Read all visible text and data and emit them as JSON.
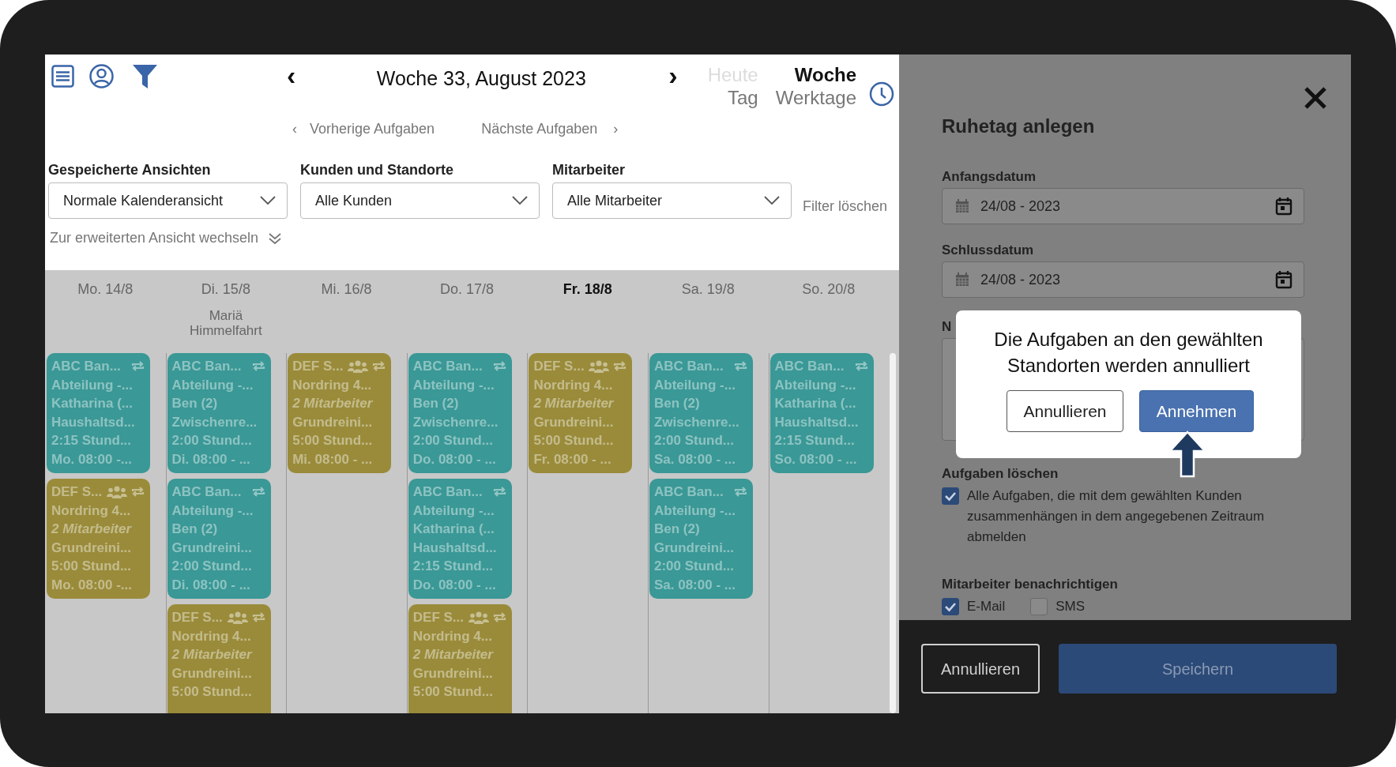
{
  "toolbar": {
    "prev": "‹",
    "title": "Woche 33, August 2023",
    "next": "›",
    "views": [
      {
        "label": "Heute",
        "selected": false,
        "disabled": true
      },
      {
        "label": "Woche",
        "selected": true,
        "disabled": false
      },
      {
        "label": "Tag",
        "selected": false,
        "disabled": false
      },
      {
        "label": "Werktage",
        "selected": false,
        "disabled": false
      }
    ]
  },
  "task_nav": {
    "prev_icon": "‹",
    "prev": "Vorherige Aufgaben",
    "next": "Nächste Aufgaben",
    "next_icon": "›"
  },
  "filters": [
    {
      "label": "Gespeicherte Ansichten",
      "value": "Normale Kalenderansicht"
    },
    {
      "label": "Kunden und Standorte",
      "value": "Alle Kunden"
    },
    {
      "label": "Mitarbeiter",
      "value": "Alle Mitarbeiter"
    }
  ],
  "clear_filters": "Filter löschen",
  "expand_view": "Zur erweiterten Ansicht wechseln",
  "days": [
    {
      "label": "Mo. 14/8",
      "selected": false,
      "tasks": [
        {
          "kind": "single",
          "color": "#3a9896",
          "lines": [
            "ABC Ban...",
            "Abteilung -...",
            "Katharina (...",
            "Haushaltsd...",
            "2:15 Stund...",
            "Mo. 08:00 -..."
          ]
        },
        {
          "kind": "team",
          "color": "#9a8b3a",
          "lines": [
            "DEF S...",
            "Nordring 4...",
            "2 Mitarbeiter",
            "Grundreini...",
            "5:00 Stund...",
            "Mo. 08:00 -..."
          ]
        }
      ]
    },
    {
      "label": "Di. 15/8",
      "selected": false,
      "holiday": "Mariä Himmelfahrt",
      "tasks": [
        {
          "kind": "single",
          "color": "#3a9896",
          "lines": [
            "ABC Ban...",
            "Abteilung -...",
            "Ben (2)",
            "Zwischenre...",
            "2:00 Stund...",
            "Di. 08:00 - ..."
          ]
        },
        {
          "kind": "single",
          "color": "#3a9896",
          "lines": [
            "ABC Ban...",
            "Abteilung -...",
            "Ben (2)",
            "Grundreini...",
            "2:00 Stund...",
            "Di. 08:00 - ..."
          ]
        },
        {
          "kind": "team",
          "color": "#9a8b3a",
          "lines": [
            "DEF S...",
            "Nordring 4...",
            "2 Mitarbeiter",
            "Grundreini...",
            "5:00 Stund..."
          ]
        }
      ]
    },
    {
      "label": "Mi. 16/8",
      "selected": false,
      "tasks": [
        {
          "kind": "team",
          "color": "#9a8b3a",
          "lines": [
            "DEF S...",
            "Nordring 4...",
            "2 Mitarbeiter",
            "Grundreini...",
            "5:00 Stund...",
            "Mi. 08:00 - ..."
          ]
        }
      ]
    },
    {
      "label": "Do. 17/8",
      "selected": false,
      "tasks": [
        {
          "kind": "single",
          "color": "#3a9896",
          "lines": [
            "ABC Ban...",
            "Abteilung -...",
            "Ben (2)",
            "Zwischenre...",
            "2:00 Stund...",
            "Do. 08:00 - ..."
          ]
        },
        {
          "kind": "single",
          "color": "#3a9896",
          "lines": [
            "ABC Ban...",
            "Abteilung -...",
            "Katharina (...",
            "Haushaltsd...",
            "2:15 Stund...",
            "Do. 08:00 - ..."
          ]
        },
        {
          "kind": "team",
          "color": "#9a8b3a",
          "lines": [
            "DEF S...",
            "Nordring 4...",
            "2 Mitarbeiter",
            "Grundreini...",
            "5:00 Stund..."
          ]
        }
      ]
    },
    {
      "label": "Fr. 18/8",
      "selected": true,
      "tasks": [
        {
          "kind": "team",
          "color": "#9a8b3a",
          "lines": [
            "DEF S...",
            "Nordring 4...",
            "2 Mitarbeiter",
            "Grundreini...",
            "5:00 Stund...",
            "Fr. 08:00 - ..."
          ]
        }
      ]
    },
    {
      "label": "Sa. 19/8",
      "selected": false,
      "tasks": [
        {
          "kind": "single",
          "color": "#3a9896",
          "lines": [
            "ABC Ban...",
            "Abteilung -...",
            "Ben (2)",
            "Zwischenre...",
            "2:00 Stund...",
            "Sa. 08:00 - ..."
          ]
        },
        {
          "kind": "single",
          "color": "#3a9896",
          "lines": [
            "ABC Ban...",
            "Abteilung -...",
            "Ben (2)",
            "Grundreini...",
            "2:00 Stund...",
            "Sa. 08:00 - ..."
          ]
        }
      ]
    },
    {
      "label": "So. 20/8",
      "selected": false,
      "tasks": [
        {
          "kind": "single",
          "color": "#3a9896",
          "lines": [
            "ABC Ban...",
            "Abteilung -...",
            "Katharina (...",
            "Haushaltsd...",
            "2:15 Stund...",
            "So. 08:00 - ..."
          ]
        }
      ]
    }
  ],
  "panel": {
    "title": "Ruhetag anlegen",
    "fields": [
      {
        "label": "Anfangsdatum",
        "value": "24/08 - 2023"
      },
      {
        "label": "Schlussdatum",
        "value": "24/08 - 2023"
      }
    ],
    "notes_label": "N",
    "delete_label": "Aufgaben löschen",
    "delete_option": {
      "label": "Alle Aufgaben, die mit dem gewählten Kunden zusammenhängen in dem angegebenen Zeitraum abmelden",
      "checked": true
    },
    "notify_label": "Mitarbeiter benachrichtigen",
    "notify_options": [
      {
        "label": "E-Mail",
        "checked": true
      },
      {
        "label": "SMS",
        "checked": false
      }
    ],
    "buttons": [
      {
        "label": "Annullieren",
        "kind": "secondary"
      },
      {
        "label": "Speichern",
        "kind": "primary"
      }
    ]
  },
  "dialog": {
    "message": "Die Aufgaben an den gewählten Standorten werden annulliert",
    "buttons": [
      {
        "label": "Annullieren",
        "kind": "secondary"
      },
      {
        "label": "Annehmen",
        "kind": "primary"
      }
    ]
  }
}
